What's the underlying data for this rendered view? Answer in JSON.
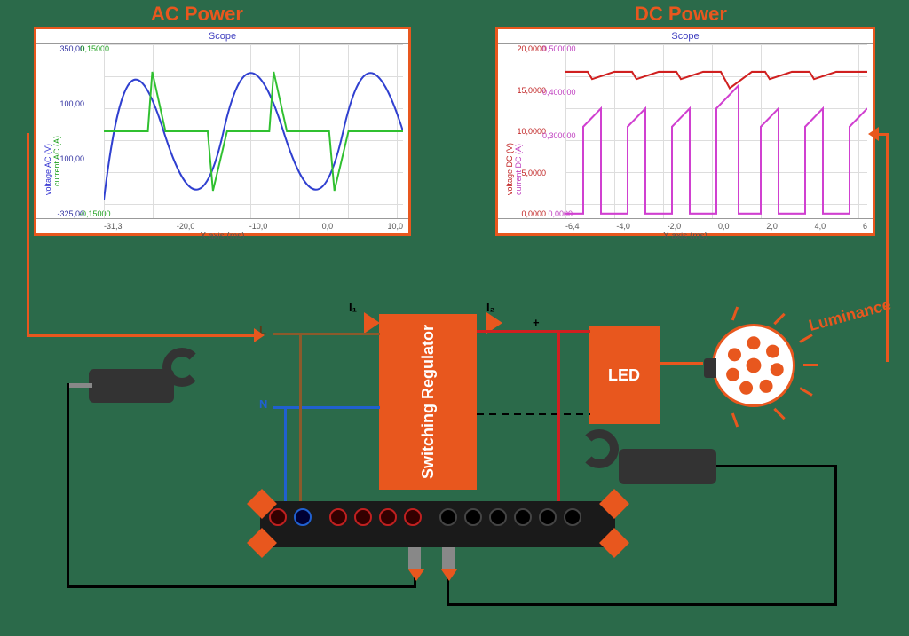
{
  "titles": {
    "ac": "AC Power",
    "dc": "DC Power",
    "scope": "Scope"
  },
  "diagram": {
    "reg_block": "Switching Regulator",
    "led_block": "LED",
    "luminance": "Luminance",
    "I1": "I₁",
    "I2": "I₂",
    "L": "L",
    "N": "N",
    "plus": "+"
  },
  "chart_data": [
    {
      "type": "line",
      "title": "Scope",
      "xlabel": "X axis (ms)",
      "xticks": [
        "-31,3",
        "-20,0",
        "-10,0",
        "0,0",
        "10,0"
      ],
      "y_axes": [
        {
          "label": "voltage AC (V)",
          "color": "#3030d0",
          "ticks": [
            "350,00",
            "100,00",
            "-100,00",
            "-325,00"
          ]
        },
        {
          "label": "current AC (A)",
          "color": "#20a020",
          "ticks": [
            "0,15000",
            "-0,15000"
          ]
        }
      ],
      "series": [
        {
          "name": "voltage AC",
          "color": "#3030d0",
          "shape": "sine",
          "amplitude": 325,
          "periods": 2.5
        },
        {
          "name": "current AC",
          "color": "#20c020",
          "shape": "pulsed-bipolar",
          "amplitude": 0.15
        }
      ]
    },
    {
      "type": "line",
      "title": "Scope",
      "xlabel": "X axis (ms)",
      "xticks": [
        "-6,4",
        "-4,0",
        "-2,0",
        "0,0",
        "2,0",
        "4,0",
        "6"
      ],
      "y_axes": [
        {
          "label": "voltage DC (V)",
          "color": "#c02020",
          "ticks": [
            "20,0000",
            "15,0000",
            "10,0000",
            "5,0000",
            "0,0000"
          ]
        },
        {
          "label": "current DC (A)",
          "color": "#c040c0",
          "ticks": [
            "0,500000",
            "0,400000",
            "0,300000",
            "0,0000"
          ]
        }
      ],
      "series": [
        {
          "name": "voltage DC",
          "color": "#d02020",
          "shape": "flat-ripple",
          "level": 17
        },
        {
          "name": "current DC",
          "color": "#d040d0",
          "shape": "pwm-ramp",
          "baseline": 0,
          "peak": 0.35,
          "pulses": 7
        }
      ]
    }
  ],
  "axis_label_x": "X axis (ms)"
}
